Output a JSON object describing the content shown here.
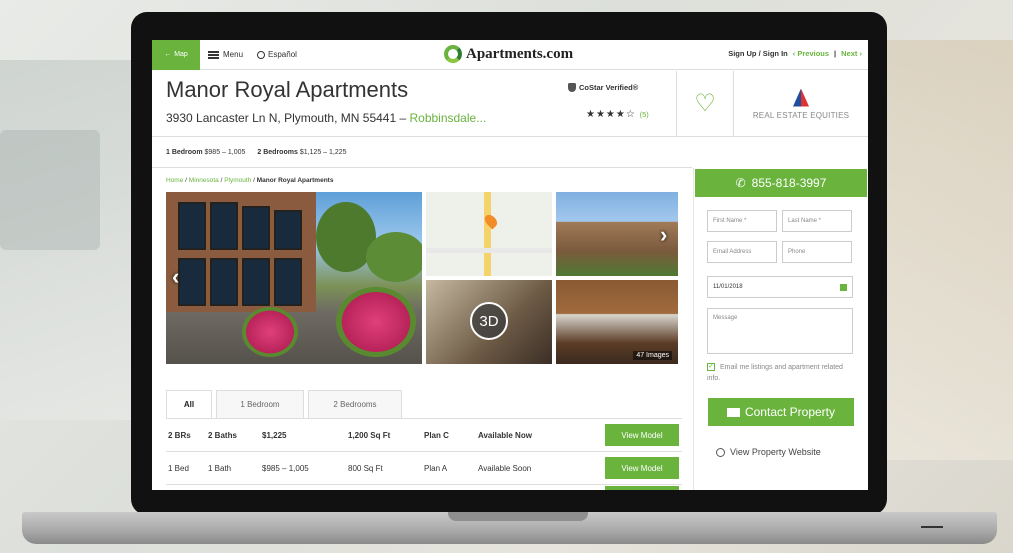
{
  "nav": {
    "map_label": "Map",
    "menu_label": "Menu",
    "espanol_label": "Español",
    "logo_text": "Apartments.com",
    "signup_label": "Sign Up / Sign In",
    "previous_label": "‹ Previous",
    "separator": "|",
    "next_label": "Next ›"
  },
  "property": {
    "title": "Manor Royal Apartments",
    "address": "3930 Lancaster Ln N, Plymouth, MN 55441 –",
    "neighborhood": "Robbinsdale...",
    "costar_label": "CoStar Verified®",
    "stars": "★★★★☆",
    "review_count": "(5)",
    "management": "REAL ESTATE EQUITIES"
  },
  "pricing": {
    "one_bed_label": "1 Bedroom",
    "one_bed_price": "$985 – 1,005",
    "two_bed_label": "2 Bedrooms",
    "two_bed_price": "$1,125 – 1,225"
  },
  "breadcrumb": {
    "home": "Home",
    "state": "Minnesota",
    "city": "Plymouth",
    "current": "Manor Royal Apartments",
    "sep": "/"
  },
  "gallery": {
    "badge_3d": "3D",
    "image_count": "47 Images"
  },
  "tabs": [
    "All",
    "1 Bedroom",
    "2 Bedrooms"
  ],
  "units": [
    {
      "beds": "2 BRs",
      "baths": "2 Baths",
      "price": "$1,225",
      "sqft": "1,200 Sq Ft",
      "plan": "Plan C",
      "availability": "Available Now",
      "button": "View Model"
    },
    {
      "beds": "1 Bed",
      "baths": "1 Bath",
      "price": "$985 – 1,005",
      "sqft": "800 Sq Ft",
      "plan": "Plan A",
      "availability": "Available Soon",
      "button": "View Model"
    }
  ],
  "contact": {
    "phone": "855-818-3997",
    "first_name_placeholder": "First Name *",
    "last_name_placeholder": "Last Name *",
    "email_placeholder": "Email Address",
    "phone_placeholder": "Phone",
    "date_value": "11/01/2018",
    "message_placeholder": "Message",
    "email_opt_in": "Email me listings and apartment related info.",
    "contact_button": "Contact Property",
    "website_link": "View Property Website"
  },
  "colors": {
    "accent": "#6ab43e",
    "text": "#333333"
  }
}
